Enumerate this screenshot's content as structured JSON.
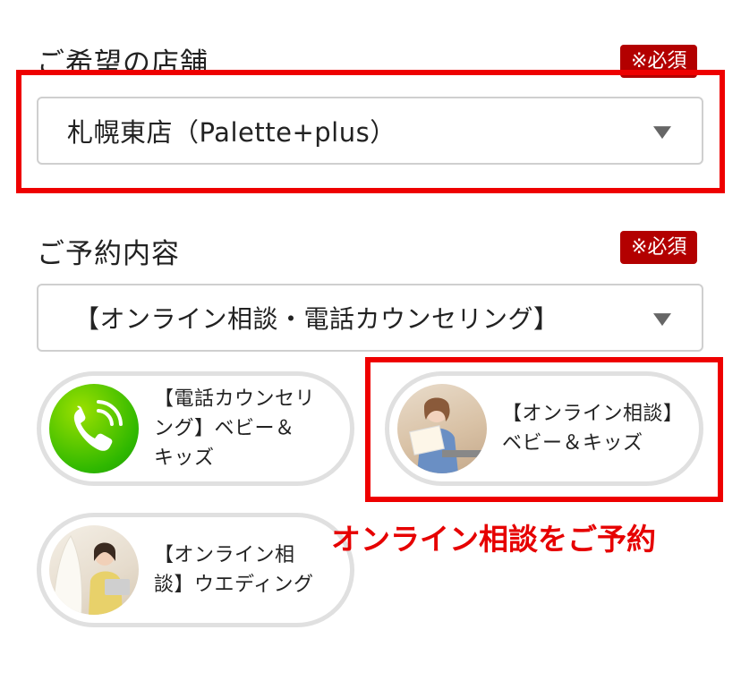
{
  "store": {
    "label": "ご希望の店舗",
    "required_badge": "※必須",
    "selected": "札幌東店（Palette+plus）"
  },
  "reservation": {
    "label": "ご予約内容",
    "required_badge": "※必須",
    "selected": "【オンライン相談・電話カウンセリング】"
  },
  "options": [
    {
      "line1": "【電話カウンセリ",
      "line2": "ング】ベビー＆",
      "line3": "キッズ",
      "icon": "phone-icon"
    },
    {
      "line1": "【オンライン相談】",
      "line2": "ベビー＆キッズ",
      "icon": "photo-baby-kids"
    },
    {
      "line1": "【オンライン相",
      "line2": "談】ウエディング",
      "icon": "photo-wedding"
    }
  ],
  "annotation": "オンライン相談をご予約",
  "colors": {
    "highlight": "#ee0000",
    "badge": "#b30000",
    "phone_green": "#33b800",
    "annotation": "#e60000"
  }
}
